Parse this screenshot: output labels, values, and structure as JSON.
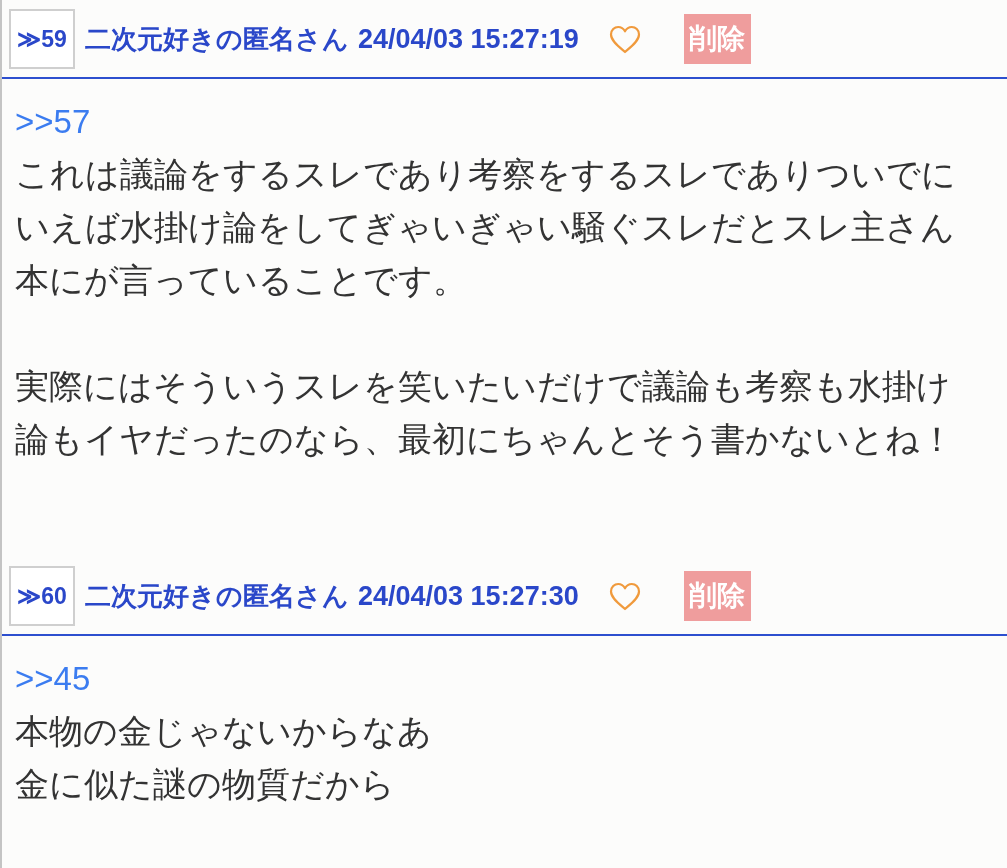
{
  "posts": [
    {
      "number": "≫59",
      "author": "二次元好きの匿名さん",
      "date": "24/04/03 15:27:19",
      "liked": false,
      "delete_label": "削除",
      "reply_to": ">>57",
      "paragraphs": [
        {
          "lines": [
            "これは議論をするスレであり考察をするスレでありついでにいえば水掛け論をしてぎゃいぎゃい騒ぐスレだとスレ主さん本にが言っていることです。"
          ]
        },
        {
          "lines": [
            "実際にはそういうスレを笑いたいだけで議論も考察も水掛け論もイヤだったのなら、最初にちゃんとそう書かないとね！"
          ]
        }
      ]
    },
    {
      "number": "≫60",
      "author": "二次元好きの匿名さん",
      "date": "24/04/03 15:27:30",
      "liked": false,
      "delete_label": "削除",
      "reply_to": ">>45",
      "paragraphs": [
        {
          "lines": [
            "本物の金じゃないからなあ",
            "金に似た謎の物質だから"
          ]
        }
      ]
    }
  ]
}
